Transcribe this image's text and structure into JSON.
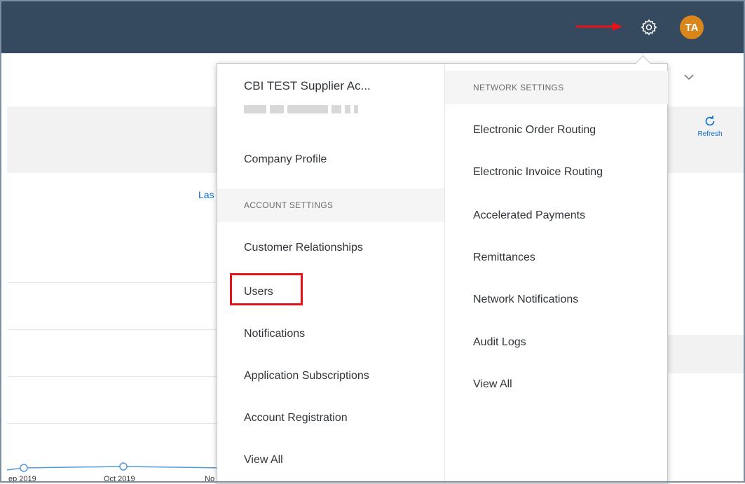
{
  "header": {
    "avatar_initials": "TA",
    "partial_label": "e"
  },
  "toolbar": {
    "refresh_label": "Refresh"
  },
  "chart": {
    "link_partial": "Las",
    "x_labels": [
      "ep 2019",
      "Oct 2019",
      "No"
    ]
  },
  "dropdown": {
    "account_name": "CBI TEST Supplier Ac...",
    "company_profile": "Company Profile",
    "account_settings": {
      "heading": "ACCOUNT SETTINGS",
      "items": [
        "Customer Relationships",
        "Users",
        "Notifications",
        "Application Subscriptions",
        "Account Registration",
        "View All"
      ]
    },
    "network_settings": {
      "heading": "NETWORK SETTINGS",
      "items": [
        "Electronic Order Routing",
        "Electronic Invoice Routing",
        "Accelerated Payments",
        "Remittances",
        "Network Notifications",
        "Audit Logs",
        "View All"
      ]
    }
  },
  "colors": {
    "shell": "#354a5f",
    "avatar": "#d9861c",
    "highlight": "#e5121a",
    "link": "#0a6ed1"
  }
}
